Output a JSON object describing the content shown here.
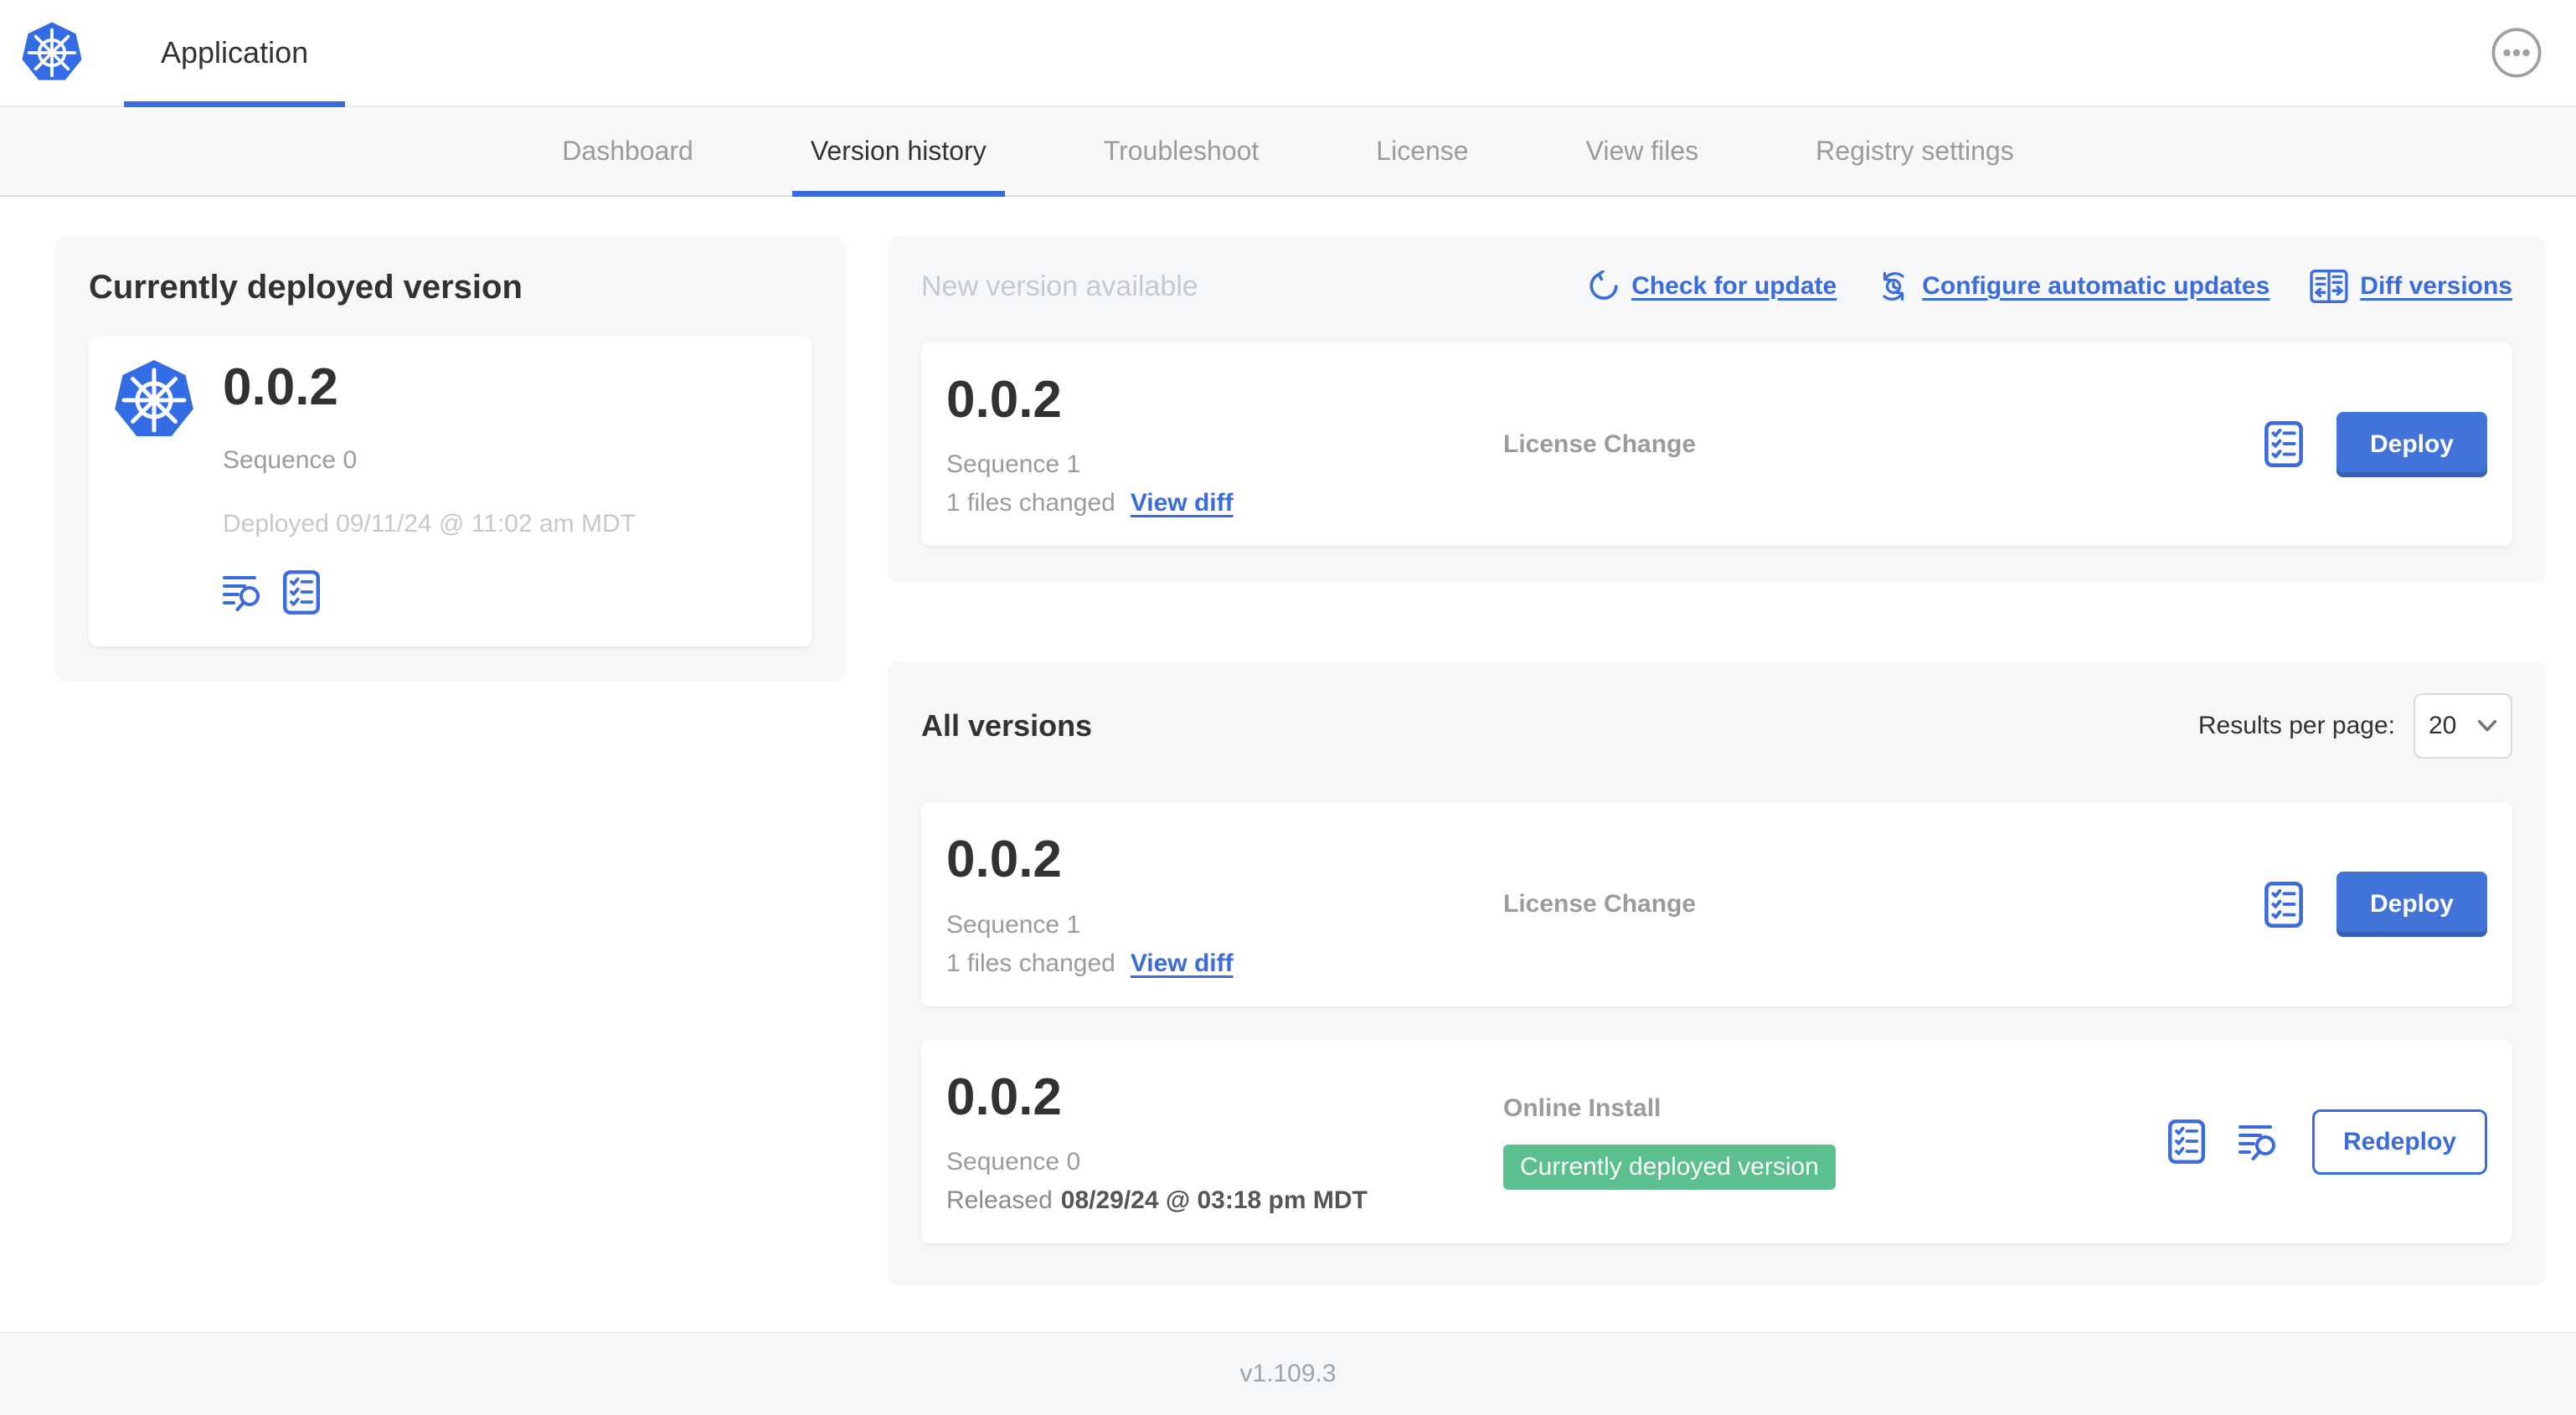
{
  "colors": {
    "accent": "#3b6cdd",
    "button_blue": "#4173d9",
    "badge_green": "#5cc08e",
    "k8s_blue": "#326de6",
    "text_dark": "#323232",
    "text_gray": "#9b9b9b",
    "text_light": "#c6c9cc"
  },
  "header": {
    "app_tab": "Application"
  },
  "nav": {
    "tabs": [
      {
        "label": "Dashboard"
      },
      {
        "label": "Version history",
        "active": true
      },
      {
        "label": "Troubleshoot"
      },
      {
        "label": "License"
      },
      {
        "label": "View files"
      },
      {
        "label": "Registry settings"
      }
    ]
  },
  "current_version": {
    "title": "Currently deployed version",
    "version": "0.0.2",
    "sequence": "Sequence 0",
    "deployed": "Deployed 09/11/24 @ 11:02 am MDT"
  },
  "new_version": {
    "title": "New version available",
    "check_for_update": "Check for update",
    "configure_automatic_updates": "Configure automatic updates",
    "diff_versions": "Diff versions",
    "card": {
      "version": "0.0.2",
      "sequence": "Sequence 1",
      "files_changed": "1 files changed",
      "view_diff": "View diff",
      "source": "License Change",
      "action": "Deploy"
    }
  },
  "all_versions": {
    "title": "All versions",
    "results_per_page_label": "Results per page:",
    "results_per_page_value": "20",
    "rows": [
      {
        "version": "0.0.2",
        "sequence": "Sequence 1",
        "files_changed": "1 files changed",
        "view_diff": "View diff",
        "source": "License Change",
        "action": "Deploy"
      },
      {
        "version": "0.0.2",
        "sequence": "Sequence 0",
        "released_prefix": "Released",
        "released_date": "08/29/24 @ 03:18 pm MDT",
        "source": "Online Install",
        "badge": "Currently deployed version",
        "action": "Redeploy"
      }
    ]
  },
  "footer": {
    "version": "v1.109.3"
  },
  "icons": {
    "logo": "kubernetes-logo",
    "overflow": "ellipsis-menu-icon",
    "check_for_update": "refresh-icon",
    "configure_automatic_updates": "clock-sync-icon",
    "diff_versions": "diff-columns-icon",
    "preflight": "checklist-icon",
    "logs": "file-search-icon",
    "select": "chevron-down-icon"
  }
}
